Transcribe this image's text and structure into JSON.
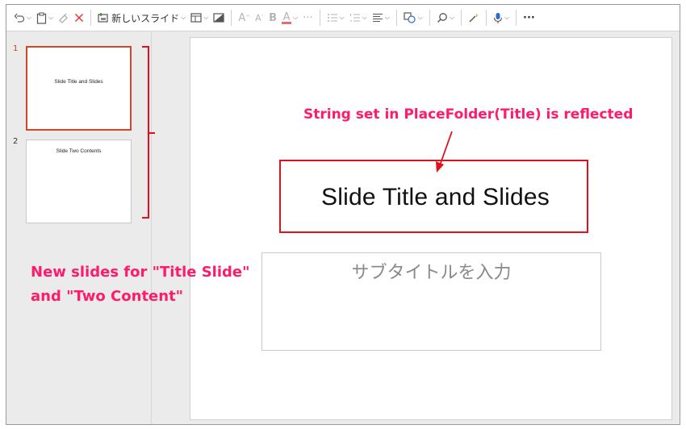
{
  "toolbar": {
    "undo_icon": "undo-icon",
    "new_slide_label": "新しいスライド",
    "font_grow_label": "A",
    "font_shrink_label": "A",
    "bold_label": "B",
    "font_color_label": "A",
    "font_color": "#e02020",
    "more_label": "···",
    "overflow_label": "···"
  },
  "thumbnails": [
    {
      "number": "1",
      "title": "Slide Title and Slides",
      "selected": true
    },
    {
      "number": "2",
      "title": "Slide Two Contents",
      "selected": false
    }
  ],
  "slide": {
    "title": "Slide Title and Slides",
    "subtitle_placeholder": "サブタイトルを入力"
  },
  "annotations": {
    "title_note": "String set in PlaceFolder(Title) is reflected",
    "slides_note_line1": "New slides for \"Title Slide\"",
    "slides_note_line2": "and \"Two Content\"",
    "color": "#ff1a6c",
    "box_color": "#e0101c"
  }
}
